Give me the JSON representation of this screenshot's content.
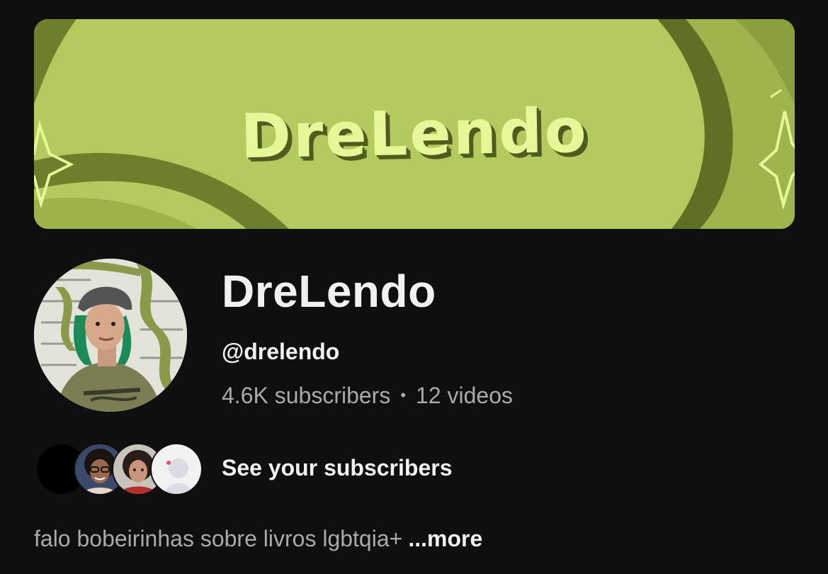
{
  "banner": {
    "title": "DreLendo",
    "colors": {
      "base": "#b4c95e",
      "dark": "#6e7f2c",
      "light": "#e6f79a"
    }
  },
  "channel": {
    "name": "DreLendo",
    "handle": "@drelendo",
    "subscribers": "4.6K subscribers",
    "separator": "•",
    "videos": "12 videos"
  },
  "subscribers_preview": {
    "label": "See your subscribers"
  },
  "description": {
    "text": "falo bobeirinhas sobre livros lgbtqia+",
    "more_label": "...more"
  }
}
